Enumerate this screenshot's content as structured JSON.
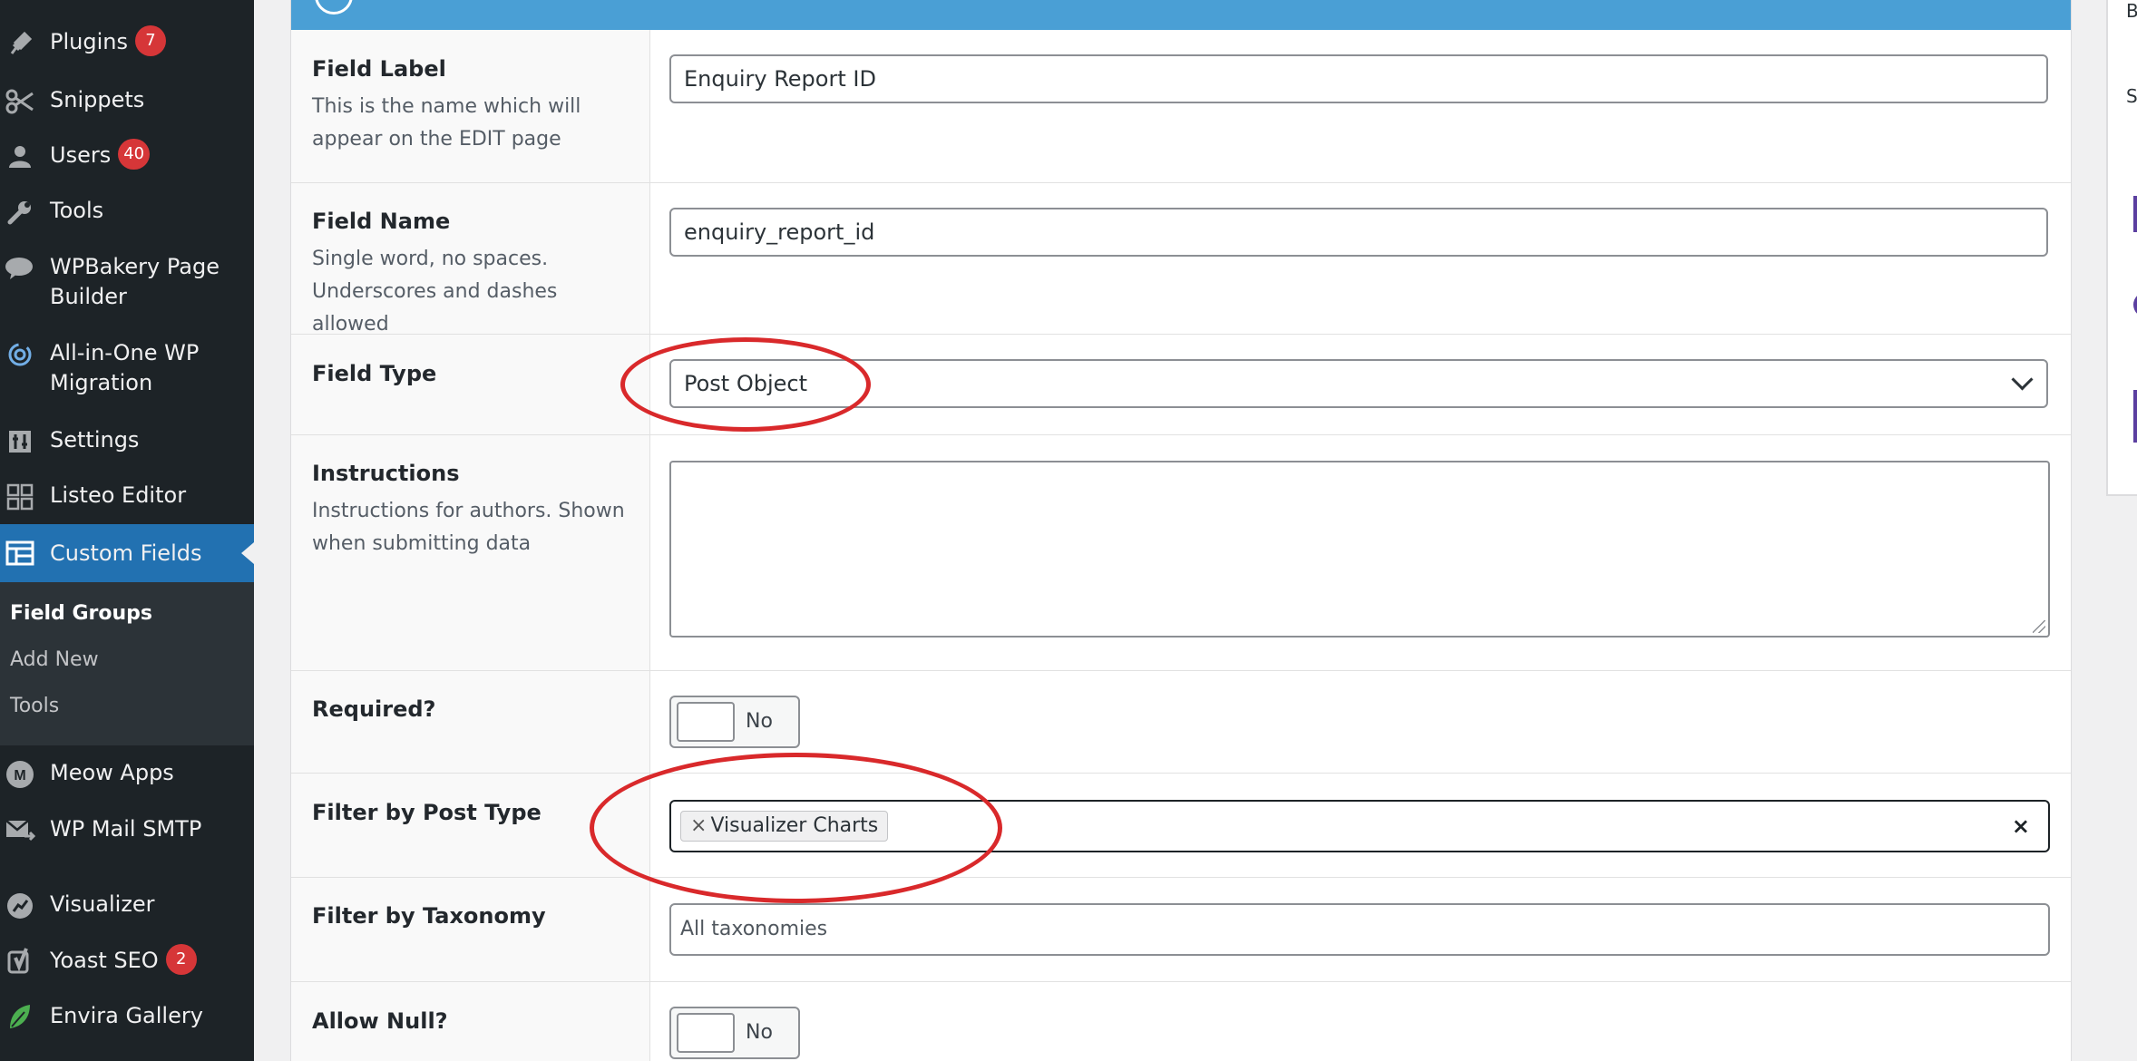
{
  "sidebar": {
    "items": [
      {
        "label": "Plugins",
        "badge": "7",
        "icon": "plugin-icon"
      },
      {
        "label": "Snippets",
        "badge": null,
        "icon": "scissors-icon"
      },
      {
        "label": "Users",
        "badge": "40",
        "icon": "users-icon"
      },
      {
        "label": "Tools",
        "badge": null,
        "icon": "wrench-icon"
      },
      {
        "label": "WPBakery Page Builder",
        "badge": null,
        "icon": "wpbakery-icon"
      },
      {
        "label": "All-in-One WP Migration",
        "badge": null,
        "icon": "migration-icon"
      },
      {
        "label": "Settings",
        "badge": null,
        "icon": "settings-icon"
      },
      {
        "label": "Listeo Editor",
        "badge": null,
        "icon": "grid-icon"
      },
      {
        "label": "Custom Fields",
        "badge": null,
        "icon": "table-icon",
        "current": true
      },
      {
        "label": "Meow Apps",
        "badge": null,
        "icon": "meow-icon"
      },
      {
        "label": "WP Mail SMTP",
        "badge": null,
        "icon": "mail-icon"
      },
      {
        "label": "Visualizer",
        "badge": null,
        "icon": "chart-icon"
      },
      {
        "label": "Yoast SEO",
        "badge": "2",
        "icon": "yoast-icon"
      },
      {
        "label": "Envira Gallery",
        "badge": null,
        "icon": "leaf-icon"
      }
    ],
    "submenu": [
      {
        "label": "Field Groups",
        "current": true
      },
      {
        "label": "Add New"
      },
      {
        "label": "Tools"
      }
    ]
  },
  "fields": {
    "label": {
      "title": "Field Label",
      "desc": "This is the name which will appear on the EDIT page",
      "value": "Enquiry Report ID"
    },
    "name": {
      "title": "Field Name",
      "desc": "Single word, no spaces. Underscores and dashes allowed",
      "value": "enquiry_report_id"
    },
    "type": {
      "title": "Field Type",
      "value": "Post Object"
    },
    "instructions": {
      "title": "Instructions",
      "desc": "Instructions for authors. Shown when submitting data",
      "value": ""
    },
    "required": {
      "title": "Required?",
      "state": "No"
    },
    "post_type": {
      "title": "Filter by Post Type",
      "chip": "Visualizer Charts",
      "chip_remove": "×",
      "clear": "×"
    },
    "taxonomy": {
      "title": "Filter by Taxonomy",
      "placeholder": "All taxonomies"
    },
    "allow_null": {
      "title": "Allow Null?",
      "state": "No"
    }
  },
  "right_panel": {
    "text_1": "B",
    "text_2": "S"
  },
  "colors": {
    "sidebar_bg": "#1d2327",
    "sidebar_active": "#2271b1",
    "header_blue": "#4a9fd5",
    "badge_red": "#d63638",
    "annotation_red": "#d9292b"
  }
}
